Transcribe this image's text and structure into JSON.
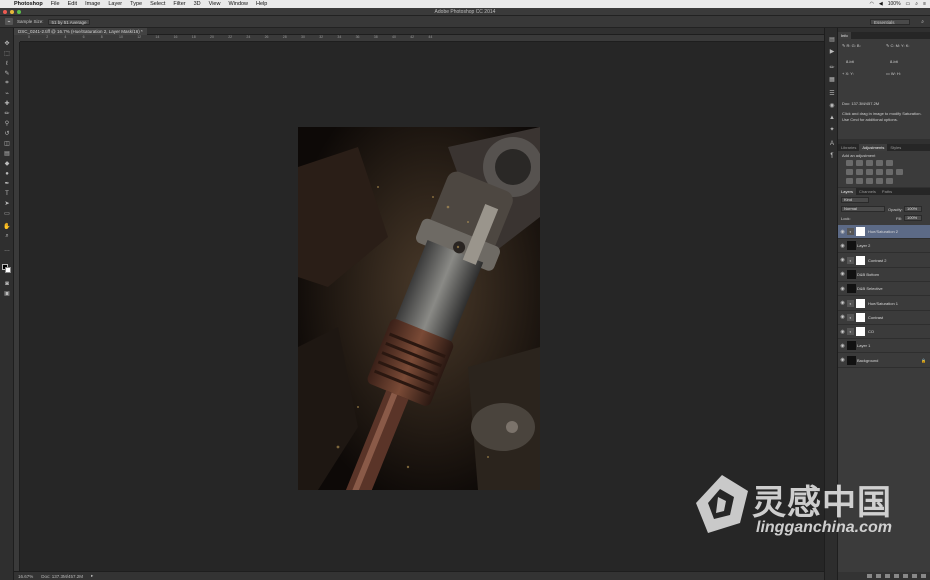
{
  "menubar": {
    "app": "Photoshop",
    "items": [
      "File",
      "Edit",
      "Image",
      "Layer",
      "Type",
      "Select",
      "Filter",
      "3D",
      "View",
      "Window",
      "Help"
    ],
    "zoom_status": "100%"
  },
  "window": {
    "title": "Adobe Photoshop CC 2014"
  },
  "options": {
    "sample_size_label": "Sample Size:",
    "sample_size_value": "51 by 51 Average",
    "workspace": "Essentials"
  },
  "document": {
    "tab_label": "DSC_0241-2.tiff @ 16.7% (Hue/Saturation 2, Layer Mask/16) *",
    "ruler_ticks": [
      "0",
      "2",
      "4",
      "6",
      "8",
      "10",
      "12",
      "14",
      "16",
      "18",
      "20",
      "22",
      "24",
      "26",
      "28",
      "30",
      "32",
      "34",
      "36",
      "38",
      "40",
      "42",
      "44"
    ]
  },
  "status": {
    "zoom": "16.67%",
    "doc_size": "Doc: 137.3M/457.2M"
  },
  "info_panel": {
    "tab": "Info",
    "doc_line": "Doc: 137.3M/457.2M",
    "hint_1": "Click and drag in image to modify Saturation.",
    "hint_2": "Use Cmd for additional options.",
    "bit_1": "8-bit",
    "bit_2": "8-bit"
  },
  "adjustments_panel": {
    "tabs": [
      "Libraries",
      "Adjustments",
      "Styles"
    ],
    "active_tab": "Adjustments",
    "heading": "Add an adjustment"
  },
  "layers_panel": {
    "tabs": [
      "Layers",
      "Channels",
      "Paths"
    ],
    "active_tab": "Layers",
    "kind_filter": "Kind",
    "blend_mode": "Normal",
    "opacity_label": "Opacity:",
    "opacity_value": "100%",
    "lock_label": "Lock:",
    "fill_label": "Fill:",
    "fill_value": "100%",
    "layers": [
      {
        "name": "Hue/Saturation 2",
        "type": "adjustment",
        "selected": true
      },
      {
        "name": "Layer 2",
        "type": "pixel",
        "selected": false
      },
      {
        "name": "Contrast 2",
        "type": "adjustment",
        "selected": false
      },
      {
        "name": "D&B Bottom",
        "type": "pixel",
        "selected": false
      },
      {
        "name": "D&B Selective",
        "type": "pixel",
        "selected": false
      },
      {
        "name": "Hue/Saturation 1",
        "type": "adjustment",
        "selected": false
      },
      {
        "name": "Contrast",
        "type": "adjustment",
        "selected": false
      },
      {
        "name": "CO",
        "type": "adjustment",
        "selected": false
      },
      {
        "name": "Layer 1",
        "type": "pixel",
        "selected": false
      },
      {
        "name": "Background",
        "type": "pixel",
        "selected": false,
        "locked": true
      }
    ]
  },
  "watermark": {
    "cn": "灵感中国",
    "en": "lingganchina.com"
  },
  "colors": {
    "selected_layer": "#5c6a86",
    "canvas_bg": "#262626"
  }
}
